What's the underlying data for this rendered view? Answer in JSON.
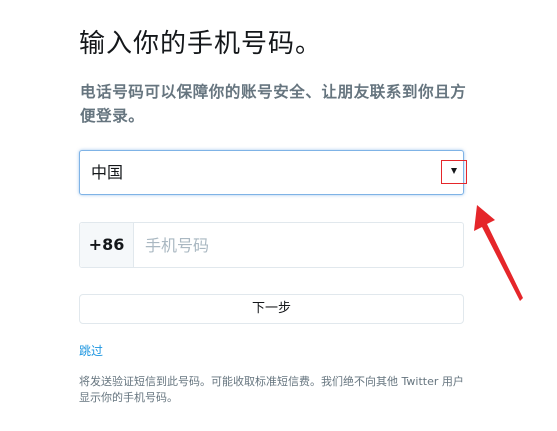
{
  "page": {
    "title": "输入你的手机号码。",
    "subtitle": "电话号码可以保障你的账号安全、让朋友联系到你且方便登录。"
  },
  "country_select": {
    "selected": "中国",
    "icon": "chevron-down-icon"
  },
  "phone": {
    "country_code": "+86",
    "placeholder": "手机号码",
    "value": ""
  },
  "actions": {
    "next_label": "下一步",
    "skip_label": "跳过"
  },
  "notice": "将发送验证短信到此号码。可能收取标准短信费。我们绝不向其他 Twitter 用户显示你的手机号码。",
  "annotations": {
    "highlight_color": "#e5262a",
    "arrow_color": "#e5262a"
  },
  "colors": {
    "link": "#1b95e0",
    "focus_border": "#7fb3e6",
    "muted_text": "#66757f"
  }
}
